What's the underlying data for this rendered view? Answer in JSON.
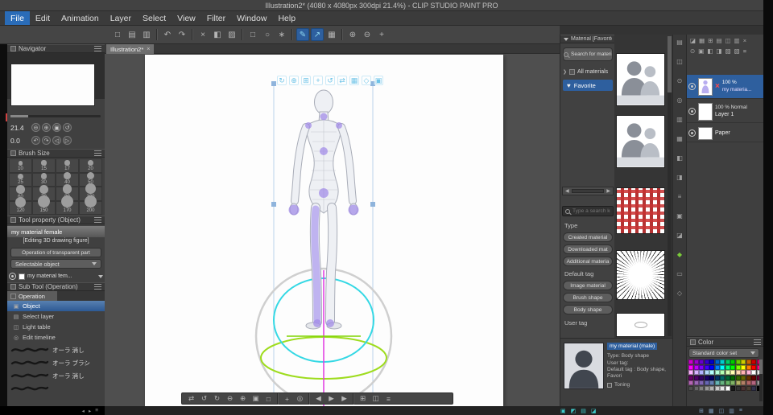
{
  "window": {
    "title": "Illustration2* (4080 x 4080px 300dpi 21.4%) - CLIP STUDIO PAINT PRO"
  },
  "menu": {
    "items": [
      {
        "label": "File",
        "selected": true
      },
      {
        "label": "Edit"
      },
      {
        "label": "Animation"
      },
      {
        "label": "Layer"
      },
      {
        "label": "Select"
      },
      {
        "label": "View"
      },
      {
        "label": "Filter"
      },
      {
        "label": "Window"
      },
      {
        "label": "Help"
      }
    ]
  },
  "toolbar": {
    "icons": [
      {
        "name": "new-file-icon",
        "glyph": "□"
      },
      {
        "name": "open-icon",
        "glyph": "▤"
      },
      {
        "name": "save-icon",
        "glyph": "▥"
      },
      {
        "sep": true
      },
      {
        "name": "undo-icon",
        "glyph": "↶"
      },
      {
        "name": "redo-icon",
        "glyph": "↷"
      },
      {
        "sep": true
      },
      {
        "name": "clear-icon",
        "glyph": "×"
      },
      {
        "name": "fill-icon",
        "glyph": "◧"
      },
      {
        "name": "gradient-icon",
        "glyph": "▨"
      },
      {
        "sep": true
      },
      {
        "name": "select-rect-icon",
        "glyph": "□"
      },
      {
        "name": "select-lasso-icon",
        "glyph": "○"
      },
      {
        "name": "select-wand-icon",
        "glyph": "∗"
      },
      {
        "sep": true
      },
      {
        "name": "snap-ruler-icon",
        "glyph": "✎",
        "selected": true
      },
      {
        "name": "snap-special-ruler-icon",
        "glyph": "↗",
        "selected": true
      },
      {
        "name": "snap-grid-icon",
        "glyph": "▦"
      },
      {
        "sep": true
      },
      {
        "name": "zoom-in-icon",
        "glyph": "⊕"
      },
      {
        "name": "zoom-out-icon",
        "glyph": "⊖"
      },
      {
        "name": "hand-tool-icon",
        "glyph": "+"
      }
    ]
  },
  "document_tab": {
    "label": "Illustration2*",
    "close_glyph": "×"
  },
  "navigator": {
    "title": "Navigator",
    "zoom_value": "21.4",
    "rotation_value": "0.0",
    "zoom_buttons": [
      {
        "name": "zoom-out-icon",
        "glyph": "⊖"
      },
      {
        "name": "zoom-in-icon",
        "glyph": "⊕"
      },
      {
        "name": "fit-to-window-icon",
        "glyph": "▣"
      },
      {
        "name": "reset-zoom-icon",
        "glyph": "↺"
      }
    ],
    "rotate_buttons": [
      {
        "name": "rotate-left-icon",
        "glyph": "↶"
      },
      {
        "name": "rotate-right-icon",
        "glyph": "↷"
      },
      {
        "name": "flip-horizontal-icon",
        "glyph": "◁"
      },
      {
        "name": "reset-rotation-icon",
        "glyph": "▷"
      }
    ]
  },
  "brush_size": {
    "title": "Brush Size",
    "sizes": [
      "10",
      "15",
      "17",
      "20",
      "25",
      "30",
      "40",
      "50",
      "60",
      "70",
      "80",
      "100",
      "120",
      "150",
      "170",
      "200"
    ]
  },
  "tool_property": {
    "title": "Tool property (Object)",
    "preset": "my material female",
    "editing": "[Editing 3D drawing figure]",
    "transparent_button": "Operation of transparent part",
    "selectable": "Selectable object",
    "layer_select": "my material fem..."
  },
  "sub_tool": {
    "title": "Sub Tool (Operation)",
    "group": "Operation",
    "items": [
      {
        "label": "Object",
        "glyph": "▣",
        "selected": true
      },
      {
        "label": "Select layer",
        "glyph": "▤"
      },
      {
        "label": "Light table",
        "glyph": "◫"
      },
      {
        "label": "Edit timeline",
        "glyph": "◎"
      }
    ],
    "brushes": [
      {
        "label": "オーラ 消し"
      },
      {
        "label": "オーラ ブラシ"
      },
      {
        "label": "オーラ 消し"
      },
      {
        "label": ""
      }
    ]
  },
  "viewport": {
    "tool_icons": [
      {
        "name": "camera-rotate-icon",
        "glyph": "↻"
      },
      {
        "name": "camera-pan-icon",
        "glyph": "⊕"
      },
      {
        "name": "camera-zoom-icon",
        "glyph": "⊞"
      },
      {
        "name": "object-move-icon",
        "glyph": "+"
      },
      {
        "name": "object-rotate-icon",
        "glyph": "↺"
      },
      {
        "name": "object-scale-icon",
        "glyph": "⇄"
      },
      {
        "name": "ground-move-icon",
        "glyph": "▦"
      },
      {
        "name": "pose-icon",
        "glyph": "◇"
      },
      {
        "name": "model-icon",
        "glyph": "▣"
      }
    ],
    "bottom_bar_icons": [
      {
        "name": "flip-view-icon",
        "glyph": "⇄"
      },
      {
        "name": "rotate-view-left-icon",
        "glyph": "↺"
      },
      {
        "name": "rotate-view-right-icon",
        "glyph": "↻"
      },
      {
        "name": "zoom-out-icon",
        "glyph": "⊖"
      },
      {
        "name": "zoom-in-icon",
        "glyph": "⊕"
      },
      {
        "name": "fit-screen-icon",
        "glyph": "▣"
      },
      {
        "name": "actual-pixels-icon",
        "glyph": "□"
      },
      {
        "sep": true
      },
      {
        "name": "grab-move-icon",
        "glyph": "+"
      },
      {
        "name": "rotate-canvas-icon",
        "glyph": "◎"
      },
      {
        "sep": true
      },
      {
        "name": "first-frame-icon",
        "glyph": "◀"
      },
      {
        "name": "play-icon",
        "glyph": "▶"
      },
      {
        "name": "next-frame-icon",
        "glyph": "▶"
      },
      {
        "sep": true
      },
      {
        "name": "grid-toggle-icon",
        "glyph": "⊞"
      },
      {
        "name": "panel-toggle-icon",
        "glyph": "◫"
      },
      {
        "name": "viewport-menu-icon",
        "glyph": "≡"
      }
    ]
  },
  "material": {
    "title": "Material [Favorite]",
    "search_button": "Search for materials",
    "all_materials": "All materials",
    "favorite": "Favorite",
    "favorite_glyph": "♥",
    "pager": {
      "prev": "◀",
      "next": "▶"
    },
    "search_placeholder": "Type a search ke",
    "type_label": "Type",
    "type_buttons": [
      "Created material",
      "Downloaded mat",
      "Additional materia"
    ],
    "default_tag_label": "Default tag",
    "default_tag_buttons": [
      "Image material",
      "Brush shape",
      "Body shape"
    ],
    "user_tag_label": "User tag",
    "info": {
      "name": "my material (male)",
      "type": "Type: Body shape",
      "user_tag": "User tag:",
      "default_tag": "Default tag : Body shape, Favori",
      "toning": "Toning"
    }
  },
  "right_strip": {
    "icons": [
      {
        "name": "quick-access-icon",
        "glyph": "▤"
      },
      {
        "name": "sub-view-icon",
        "glyph": "◫"
      },
      {
        "name": "brush-size-panel-icon",
        "glyph": "⊙"
      },
      {
        "name": "color-wheel-icon",
        "glyph": "◎"
      },
      {
        "name": "color-slider-icon",
        "glyph": "▥"
      },
      {
        "name": "color-set-icon",
        "glyph": "▦"
      },
      {
        "name": "intermediate-color-icon",
        "glyph": "◧"
      },
      {
        "name": "approximate-color-icon",
        "glyph": "◨"
      },
      {
        "name": "color-history-icon",
        "glyph": "≡"
      },
      {
        "name": "layer-panel-icon",
        "glyph": "▣"
      },
      {
        "name": "layer-property-icon",
        "glyph": "◪"
      },
      {
        "name": "material-green-icon",
        "glyph": "◆",
        "color": "#7acb3a"
      },
      {
        "name": "timeline-icon",
        "glyph": "▭"
      },
      {
        "name": "information-icon",
        "glyph": "◇"
      }
    ]
  },
  "layer": {
    "header_icons_row1": [
      {
        "name": "blend-icon",
        "glyph": "◪"
      },
      {
        "name": "new-layer-icon",
        "glyph": "▦"
      },
      {
        "name": "new-folder-icon",
        "glyph": "⊞"
      },
      {
        "name": "transfer-icon",
        "glyph": "▤"
      },
      {
        "name": "merge-icon",
        "glyph": "◫"
      },
      {
        "name": "mask-icon",
        "glyph": "▥"
      },
      {
        "name": "delete-layer-icon",
        "glyph": "×"
      }
    ],
    "header_icons_row2": [
      {
        "name": "visibility-icon",
        "glyph": "⊙"
      },
      {
        "name": "lock-icon",
        "glyph": "▣"
      },
      {
        "name": "lock-alpha-icon",
        "glyph": "◧"
      },
      {
        "name": "clip-icon",
        "glyph": "◨"
      },
      {
        "name": "reference-icon",
        "glyph": "▨"
      },
      {
        "name": "ruler-icon",
        "glyph": "▧"
      },
      {
        "name": "layer-menu-icon",
        "glyph": "≡"
      }
    ],
    "layers": [
      {
        "opacity": "100 %",
        "name": "my materia...",
        "badge": "×",
        "selected": true
      },
      {
        "opacity": "100 % Normal",
        "name": "Layer 1"
      },
      {
        "opacity": "",
        "name": "Paper"
      }
    ]
  },
  "color": {
    "title": "Color",
    "set_name": "Standard color set",
    "palette": [
      "#cc00cc",
      "#9900cc",
      "#6600cc",
      "#3300cc",
      "#0000cc",
      "#0066cc",
      "#00cccc",
      "#00cc66",
      "#00cc00",
      "#66cc00",
      "#cccc00",
      "#cc6600",
      "#cc0000",
      "#cc0066",
      "#ff00ff",
      "#bf00ff",
      "#8000ff",
      "#4000ff",
      "#0000ff",
      "#0080ff",
      "#00ffff",
      "#00ff80",
      "#00ff00",
      "#80ff00",
      "#ffff00",
      "#ff8000",
      "#ff0000",
      "#ff0080",
      "#ffb3ff",
      "#d9b3ff",
      "#b3b3ff",
      "#b3d9ff",
      "#b3ffff",
      "#b3ffd9",
      "#b3ffb3",
      "#d9ffb3",
      "#ffffb3",
      "#ffd9b3",
      "#ffb3b3",
      "#ffb3d9",
      "#ffffff",
      "#e6e6e6",
      "#660066",
      "#4d0066",
      "#330066",
      "#1a0066",
      "#000066",
      "#003366",
      "#006666",
      "#006633",
      "#006600",
      "#336600",
      "#666600",
      "#663300",
      "#660000",
      "#660033",
      "#b366b3",
      "#9966b3",
      "#8066b3",
      "#6666b3",
      "#6680b3",
      "#66b3b3",
      "#66b380",
      "#66b366",
      "#80b366",
      "#b3b366",
      "#b38066",
      "#b36666",
      "#b36680",
      "#999999",
      "#4d4d4d",
      "#666666",
      "#808080",
      "#999999",
      "#b3b3b3",
      "#cccccc",
      "#e6e6e6",
      "#ffffff",
      "#1a1a1a",
      "#333333",
      "#4d3333",
      "#4d4033",
      "#33334d",
      "#000000"
    ]
  },
  "status_bar": {
    "left_icons": [
      {
        "name": "collapse-left-icon",
        "glyph": "◂"
      },
      {
        "name": "expand-left-icon",
        "glyph": "▸"
      },
      {
        "name": "dock-menu-icon",
        "glyph": "≡"
      }
    ],
    "teal_icons": [
      {
        "name": "workspace-icon",
        "glyph": "▣"
      },
      {
        "name": "cloud-icon",
        "glyph": "◩"
      },
      {
        "name": "sync-icon",
        "glyph": "▤"
      },
      {
        "name": "device-icon",
        "glyph": "◪"
      }
    ],
    "right_icons": [
      {
        "name": "grid-status-icon",
        "glyph": "⊞"
      },
      {
        "name": "layers-status-icon",
        "glyph": "▦"
      },
      {
        "name": "split-status-icon",
        "glyph": "◫"
      },
      {
        "name": "rows-status-icon",
        "glyph": "▥"
      },
      {
        "name": "status-menu-icon",
        "glyph": "≡"
      }
    ]
  }
}
